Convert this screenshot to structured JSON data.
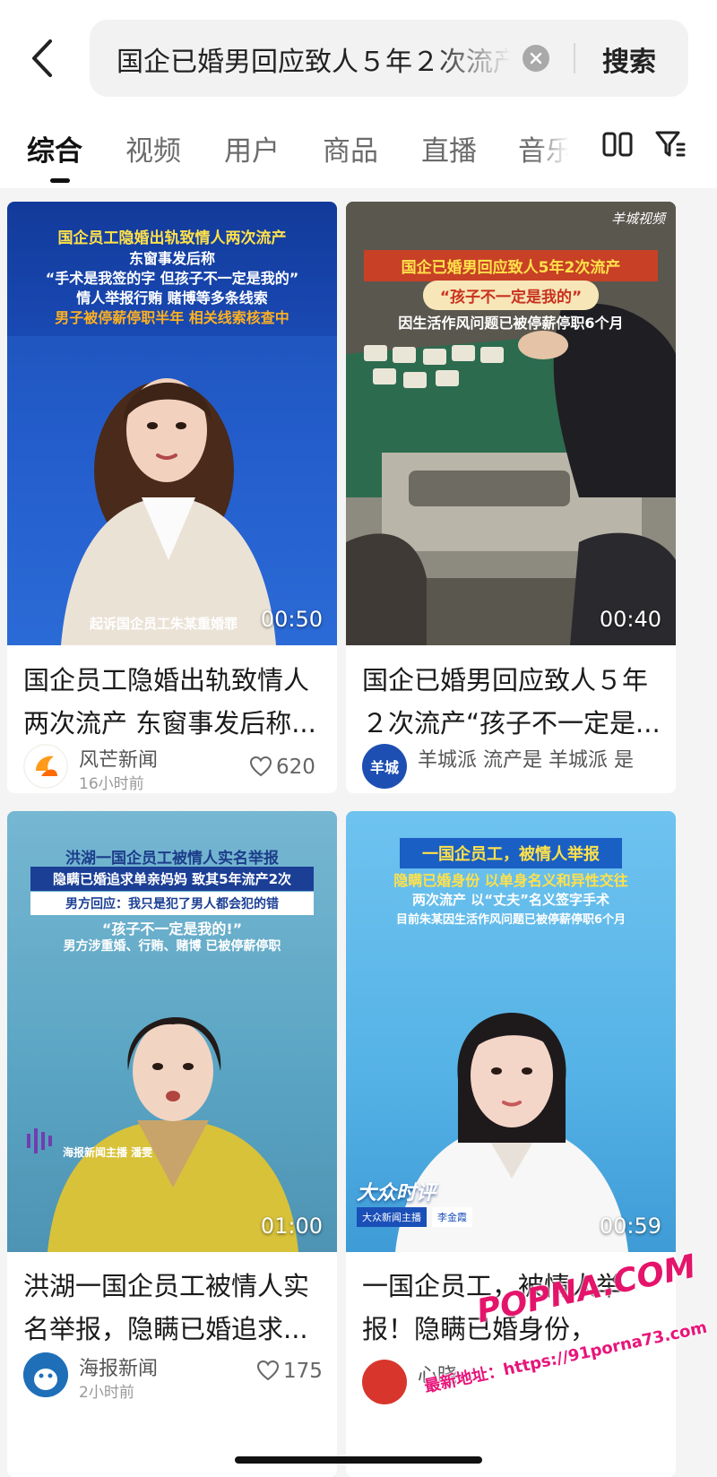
{
  "search": {
    "query": "国企已婚男回应致人５年２次流产",
    "button_label": "搜索"
  },
  "tabs": [
    {
      "label": "综合",
      "active": true
    },
    {
      "label": "视频",
      "active": false
    },
    {
      "label": "用户",
      "active": false
    },
    {
      "label": "商品",
      "active": false
    },
    {
      "label": "直播",
      "active": false
    },
    {
      "label": "音乐",
      "active": false
    }
  ],
  "icons": {
    "back": "back-chevron-icon",
    "clear": "clear-icon",
    "layout": "dual-column-icon",
    "filter": "filter-icon",
    "like": "heart-icon"
  },
  "colors": {
    "accent_yellow": "#ffe14a",
    "accent_orange": "#ff8a1e",
    "tab_active": "#111111",
    "tab_inactive": "#6b6b6b"
  },
  "cards": [
    {
      "overlay_lines": [
        "国企员工隐婚出轨致情人两次流产",
        "东窗事发后称",
        "“手术是我签的字 但孩子不一定是我的”",
        "情人举报行贿 赌博等多条线索",
        "男子被停薪停职半年 相关线索核查中"
      ],
      "bottom_caption": "起诉国企员工朱某重婚罪",
      "duration": "00:50",
      "title": "国企员工隐婚出轨致情人两次流产 东窗事发后称...",
      "author": "风芒新闻",
      "time": "16小时前",
      "likes": "620"
    },
    {
      "logo": "羊城视频",
      "overlay_lines": [
        "国企已婚男回应致人5年2次流产",
        "“孩子不一定是我的”",
        "因生活作风问题已被停薪停职6个月"
      ],
      "duration": "00:40",
      "title": "国企已婚男回应致人５年２次流产“孩子不一定是...",
      "author": "羊城",
      "author_line": "羊城派 流产是 羊城派 是",
      "avatar_text": "羊城"
    },
    {
      "overlay_lines": [
        "洪湖一国企员工被情人实名举报",
        "隐瞒已婚追求单亲妈妈 致其5年流产2次",
        "男方回应：我只是犯了男人都会犯的错",
        "“孩子不一定是我的!”",
        "男方涉重婚、行贿、赌博 已被停薪停职"
      ],
      "anchor_caption": "海报新闻主播 潘雯",
      "duration": "01:00",
      "title": "洪湖一国企员工被情人实名举报，隐瞒已婚追求...",
      "author": "海报新闻",
      "time": "2小时前",
      "likes": "175"
    },
    {
      "overlay_lines": [
        "一国企员工，被情人举报",
        "隐瞒已婚身份 以单身名义和异性交往",
        "两次流产 以“丈夫”名义签字手术",
        "目前朱某因生活作风问题已被停薪停职6个月"
      ],
      "brand_caption": "大众时评",
      "anchor_caption": "大众新闻主播",
      "anchor_name": "李金霞",
      "duration": "00:59",
      "title": "一国企员工，被情人举报！隐瞒已婚身份，",
      "author_partial": "心晓"
    }
  ],
  "watermark": {
    "line1": "POPNA.COM",
    "line2": "最新地址：https://91porna73.com"
  }
}
